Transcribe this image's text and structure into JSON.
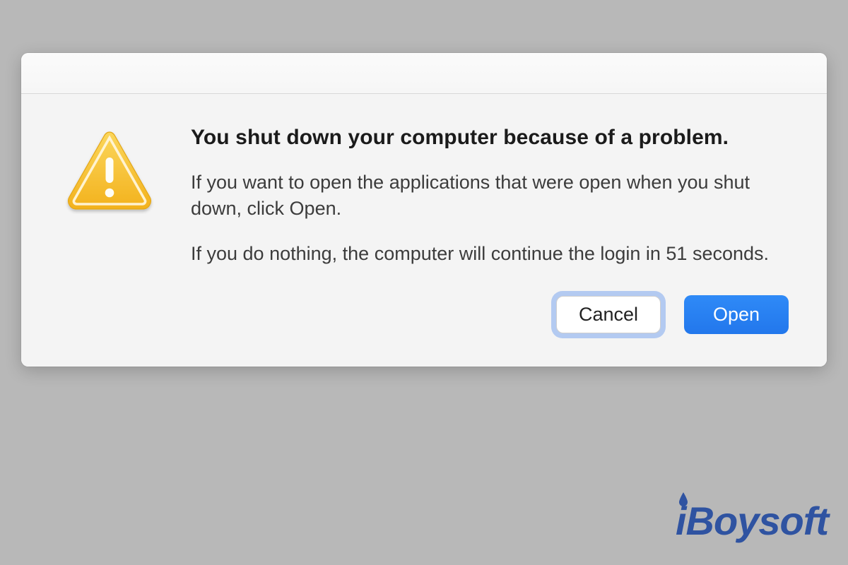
{
  "dialog": {
    "heading": "You shut down your computer because of a problem.",
    "message": "If you want to open the applications that were open when you shut down, click Open.",
    "countdown": "If you do nothing, the computer will continue the login in 51 seconds.",
    "actions": {
      "cancel_label": "Cancel",
      "open_label": "Open"
    }
  },
  "watermark": {
    "text": "iBoysoft"
  },
  "colors": {
    "primary_button": "#2f8af7",
    "focus_ring": "#387AEB",
    "warning_triangle": "#F5C138"
  }
}
